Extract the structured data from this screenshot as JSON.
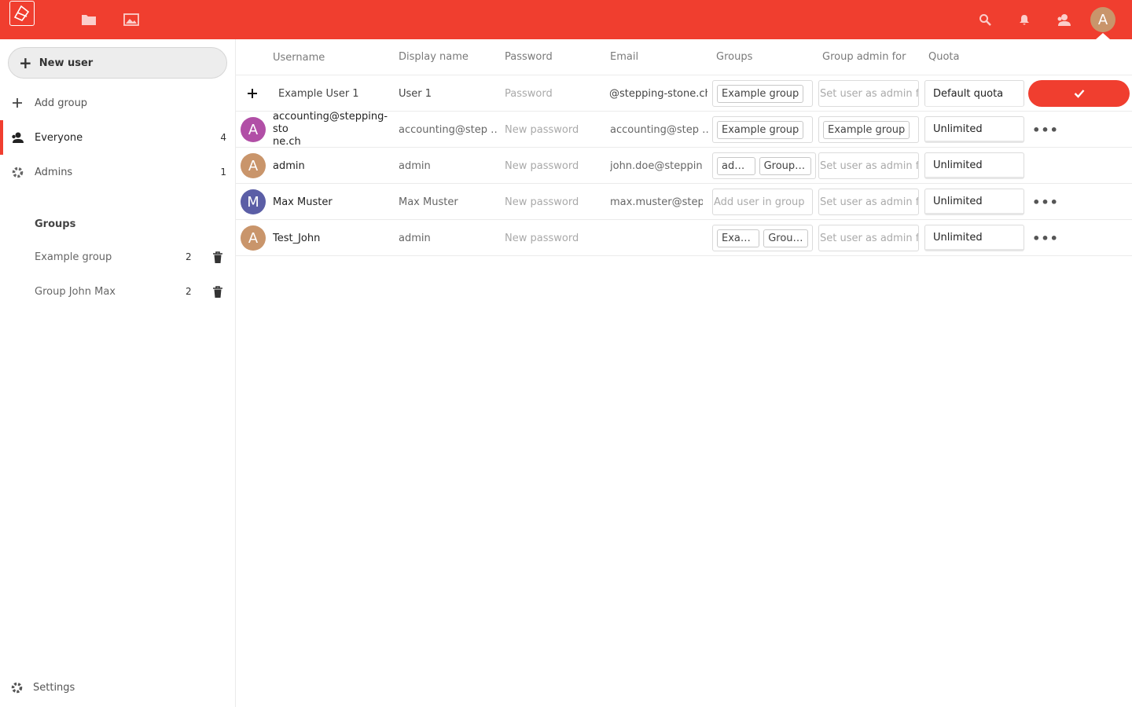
{
  "header": {
    "avatar_letter": "A",
    "accent": "#f03e2f",
    "icons": [
      "logo-icon",
      "files-icon",
      "photos-icon",
      "search-icon",
      "notifications-icon",
      "contacts-icon"
    ]
  },
  "sidebar": {
    "new_user_label": "New user",
    "add_group_label": "Add group",
    "everyone": {
      "label": "Everyone",
      "count": "4"
    },
    "admins": {
      "label": "Admins",
      "count": "1"
    },
    "groups_header": "Groups",
    "groups": [
      {
        "label": "Example group",
        "count": "2"
      },
      {
        "label": "Group John Max",
        "count": "2"
      }
    ],
    "settings_label": "Settings"
  },
  "table": {
    "headers": {
      "username": "Username",
      "display_name": "Display name",
      "password": "Password",
      "email": "Email",
      "groups": "Groups",
      "group_admin": "Group admin for",
      "quota": "Quota"
    },
    "new_row": {
      "username": "Example User 1",
      "display_name": "User 1",
      "password_placeholder": "Password",
      "email": "@stepping-stone.ch",
      "group": "Example group",
      "admin_placeholder": "Set user as admin for",
      "quota": "Default quota"
    },
    "rows": [
      {
        "avatar": "A",
        "avatar_color": "#b14fa6",
        "username": "accounting@stepping-stone.ch",
        "username_line1": "accounting@stepping-sto",
        "username_line2": "ne.ch",
        "display_name": "accounting@step …",
        "password": "New password",
        "email": "accounting@step …",
        "groups": [
          "Example group"
        ],
        "admin_for": [
          "Example group"
        ],
        "quota": "Unlimited"
      },
      {
        "avatar": "A",
        "avatar_color": "#c9956b",
        "username": "admin",
        "display_name": "admin",
        "password": "New password",
        "email": "john.doe@steppin…",
        "groups": [
          "admin",
          "Group J…"
        ],
        "admin_placeholder": "Set user as admin for",
        "quota": "Unlimited"
      },
      {
        "avatar": "M",
        "avatar_color": "#5b5ea6",
        "username": "Max Muster",
        "display_name": "Max Muster",
        "password": "New password",
        "email": "max.muster@step…",
        "groups_placeholder": "Add user in group",
        "admin_placeholder": "Set user as admin for",
        "quota": "Unlimited"
      },
      {
        "avatar": "A",
        "avatar_color": "#c9956b",
        "username": "Test_John",
        "display_name": "admin",
        "password": "New password",
        "email": "",
        "groups": [
          "Exam…",
          "Group…"
        ],
        "admin_placeholder": "Set user as admin for",
        "quota": "Unlimited"
      }
    ]
  }
}
